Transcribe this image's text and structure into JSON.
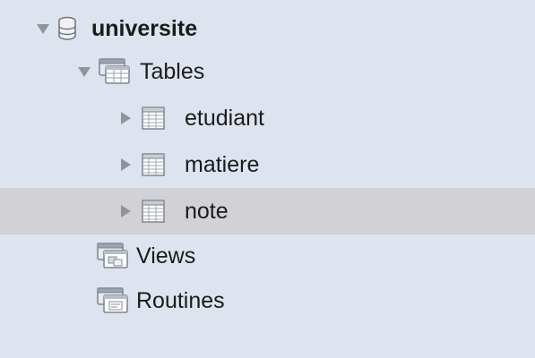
{
  "tree": {
    "database": {
      "label": "universite",
      "icon": "database-icon",
      "expanded": true
    },
    "tables_group": {
      "label": "Tables",
      "icon": "tables-folder-icon",
      "expanded": true
    },
    "tables": [
      {
        "label": "etudiant",
        "icon": "table-icon",
        "selected": false
      },
      {
        "label": "matiere",
        "icon": "table-icon",
        "selected": false
      },
      {
        "label": "note",
        "icon": "table-icon",
        "selected": true
      }
    ],
    "views_group": {
      "label": "Views",
      "icon": "views-folder-icon"
    },
    "routines_group": {
      "label": "Routines",
      "icon": "routines-folder-icon"
    }
  },
  "colors": {
    "sidebar_bg": "#dde4ef",
    "selected_row_bg": "#d2d2d6",
    "text": "#1b1b1b",
    "disclosure": "#8a8f98"
  }
}
